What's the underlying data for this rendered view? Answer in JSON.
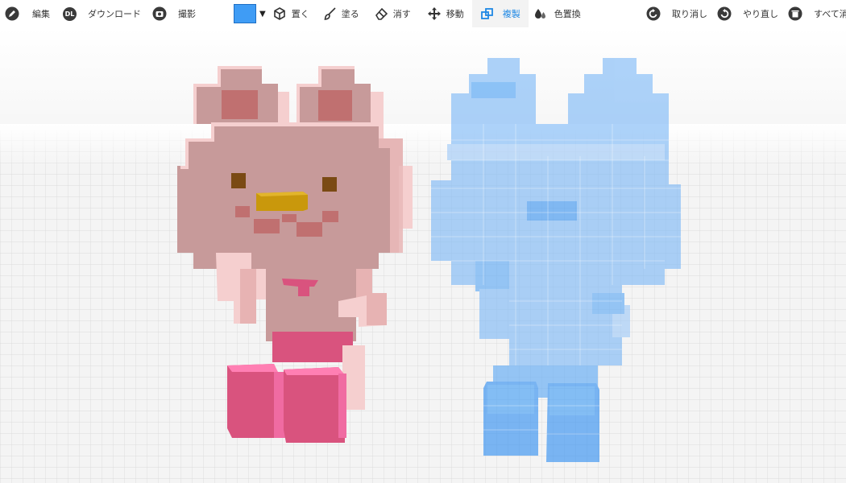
{
  "toolbar": {
    "left": {
      "edit_label": "編集",
      "download_badge": "DL",
      "download_label": "ダウンロード",
      "capture_label": "撮影"
    },
    "current_color": "#3f9cf5",
    "tools": {
      "place_label": "置く",
      "paint_label": "塗る",
      "erase_label": "消す",
      "move_label": "移動",
      "duplicate_label": "複製",
      "replace_color_label": "色置換"
    },
    "active_tool": "duplicate",
    "right": {
      "undo_label": "取り消し",
      "redo_label": "やり直し",
      "clear_all_label": "すべて消す"
    }
  },
  "colors": {
    "accent": "#1e88e5",
    "pink_body": "#c79a9a",
    "pink_light": "#f5cfcf",
    "pink_feet": "#d9537e",
    "beak": "#c9980c",
    "eyes": "#7a4a14",
    "ghost_blue": "#7cb8f7"
  }
}
